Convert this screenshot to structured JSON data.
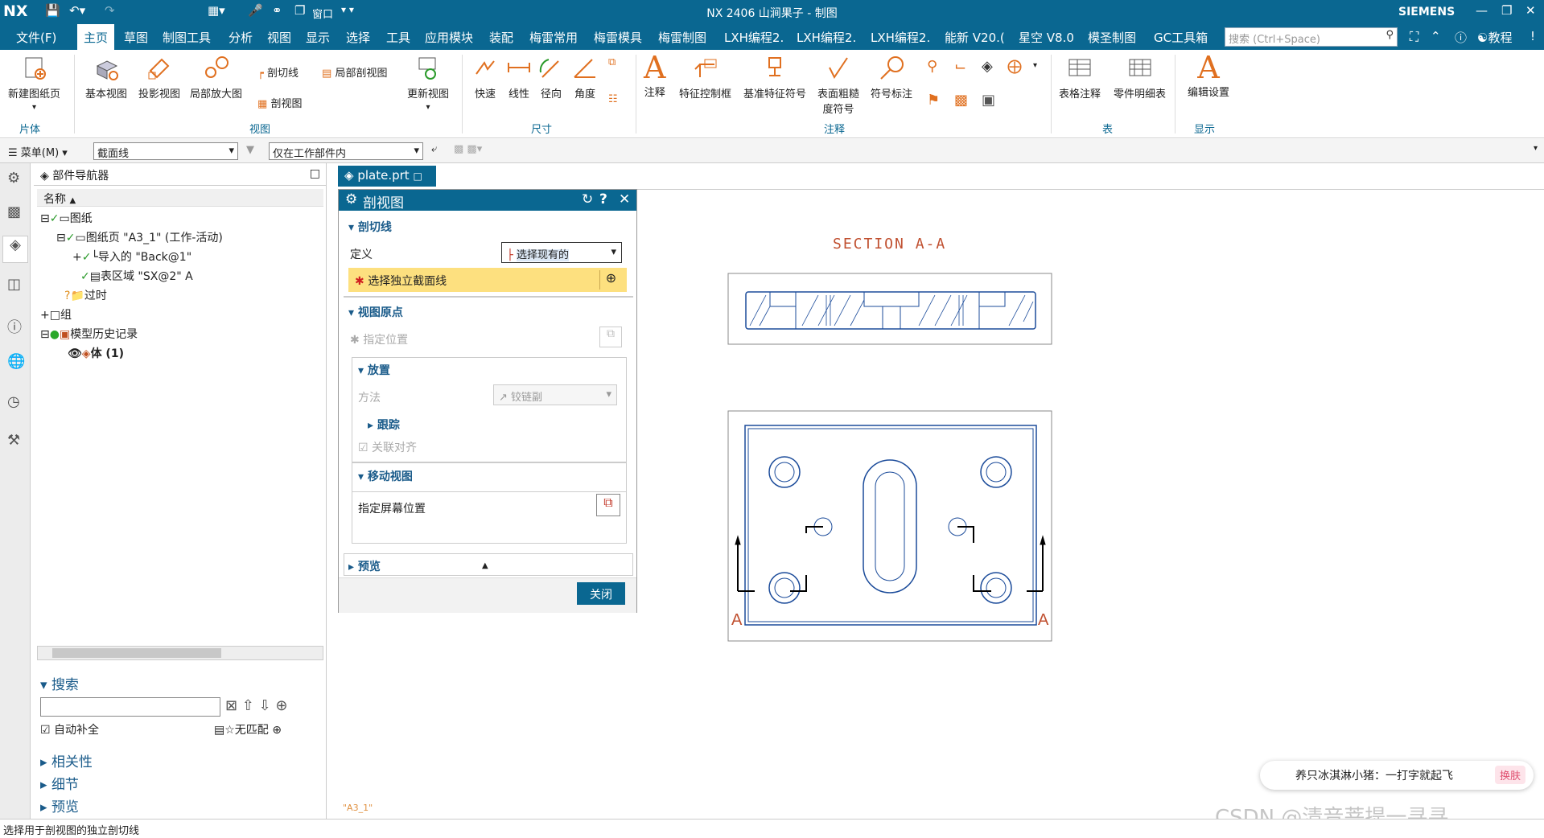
{
  "titlebar": {
    "logo": "NX",
    "title": "NX 2406 山涧果子 - 制图",
    "brand": "SIEMENS",
    "window_menu": "窗口"
  },
  "menu": {
    "items": [
      "文件(F)",
      "主页",
      "草图",
      "制图工具",
      "分析",
      "视图",
      "显示",
      "选择",
      "工具",
      "应用模块",
      "装配",
      "梅雷常用",
      "梅雷模具",
      "梅雷制图",
      "LXH编程2.",
      "LXH编程2.",
      "LXH编程2.",
      "能新 V20.(",
      "星空 V8.0",
      "模圣制图",
      "GC工具箱"
    ],
    "active": "主页",
    "search_placeholder": "搜索 (Ctrl+Space)",
    "tutorial": "教程"
  },
  "ribbon": {
    "new_sheet": "新建图纸页",
    "base_view": "基本视图",
    "proj_view": "投影视图",
    "detail_view": "局部放大图",
    "section_line": "剖切线",
    "break_section": "局部剖视图",
    "section_view": "剖视图",
    "update_view": "更新视图",
    "rapid": "快速",
    "linear": "线性",
    "radial": "径向",
    "angle": "角度",
    "note": "注释",
    "fcf": "特征控制框",
    "datum": "基准特征符号",
    "surface_finish_1": "表面粗糙",
    "surface_finish_2": "度符号",
    "balloon": "符号标注",
    "table_note": "表格注释",
    "parts_list": "零件明细表",
    "edit_settings": "编辑设置",
    "groups": {
      "sheet": "片体",
      "view": "视图",
      "dimension": "尺寸",
      "annotation": "注释",
      "table": "表",
      "display": "显示"
    }
  },
  "toolbar": {
    "menu": "菜单(M)",
    "filter": "截面线",
    "scope": "仅在工作部件内"
  },
  "navigator": {
    "title": "部件导航器",
    "col_name": "名称",
    "tree": [
      "图纸",
      "图纸页 \"A3_1\" (工作-活动)",
      "导入的 \"Back@1\"",
      "表区域 \"SX@2\" A",
      "过时",
      "组",
      "模型历史记录",
      "体 (1)"
    ],
    "search": "搜索",
    "auto_complete": "自动补全",
    "no_match": "无匹配",
    "related": "相关性",
    "details": "细节",
    "preview": "预览"
  },
  "tab": {
    "file": "plate.prt"
  },
  "dialog": {
    "title": "剖视图",
    "sec_cutline": "剖切线",
    "define_lbl": "定义",
    "define_val": "选择现有的",
    "select_cut": "选择独立截面线",
    "sec_origin": "视图原点",
    "specify_loc": "指定位置",
    "sec_place": "放置",
    "method_lbl": "方法",
    "method_val": "铰链副",
    "track": "跟踪",
    "assoc_align": "关联对齐",
    "sec_move": "移动视图",
    "screen_pos": "指定屏幕位置",
    "sec_preview": "预览",
    "close": "关闭"
  },
  "drawing": {
    "section_title": "SECTION  A-A",
    "label_left": "A",
    "label_right": "A",
    "sheet": "\"A3_1\""
  },
  "status": {
    "text": "选择用于剖视图的独立剖切线"
  },
  "ime": {
    "text": "养只冰淇淋小猪：一打字就起飞",
    "skin": "换肤",
    "watermark": "CSDN @清音菩提一寻寻"
  }
}
